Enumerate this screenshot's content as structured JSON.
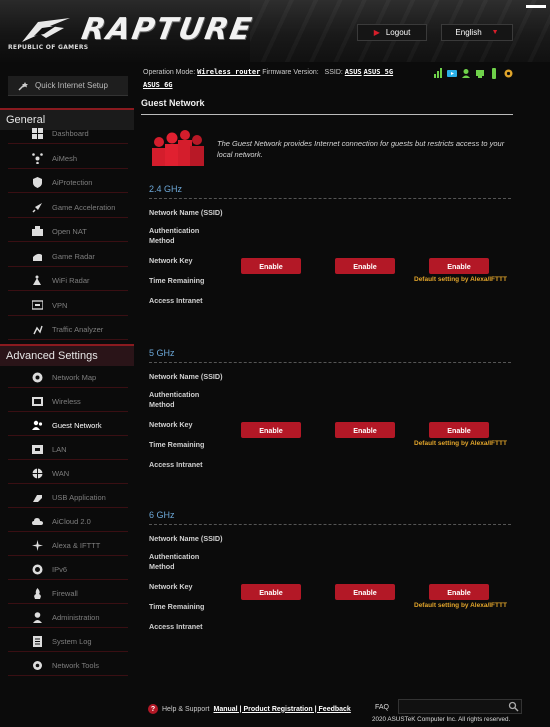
{
  "header": {
    "brand_sub": "REPUBLIC OF GAMERS",
    "brand_title": "RAPTURE",
    "logout_label": "Logout",
    "language": "English"
  },
  "status": {
    "op_mode_label": "Operation Mode:",
    "op_mode_value": "Wireless router",
    "fw_label": "Firmware Version:",
    "ssid_label": "SSID:",
    "ssid_values": [
      "ASUS",
      "ASUS_5G",
      "ASUS_6G"
    ]
  },
  "sidebar": {
    "quick_setup": "Quick Internet Setup",
    "general_header": "General",
    "general_items": [
      {
        "label": "Dashboard",
        "icon": "dashboard-icon"
      },
      {
        "label": "AiMesh",
        "icon": "aimesh-icon"
      },
      {
        "label": "AiProtection",
        "icon": "shield-icon"
      },
      {
        "label": "Game Acceleration",
        "icon": "rocket-icon"
      },
      {
        "label": "Open NAT",
        "icon": "open-nat-icon"
      },
      {
        "label": "Game Radar",
        "icon": "radar-icon"
      },
      {
        "label": "WiFi Radar",
        "icon": "wifi-radar-icon"
      },
      {
        "label": "VPN",
        "icon": "vpn-icon"
      },
      {
        "label": "Traffic Analyzer",
        "icon": "traffic-icon"
      }
    ],
    "advanced_header": "Advanced Settings",
    "advanced_items": [
      {
        "label": "Network Map",
        "icon": "network-map-icon"
      },
      {
        "label": "Wireless",
        "icon": "wireless-icon"
      },
      {
        "label": "Guest Network",
        "icon": "guest-network-icon",
        "active": true
      },
      {
        "label": "LAN",
        "icon": "lan-icon"
      },
      {
        "label": "WAN",
        "icon": "globe-icon"
      },
      {
        "label": "USB Application",
        "icon": "usb-icon"
      },
      {
        "label": "AiCloud 2.0",
        "icon": "cloud-icon"
      },
      {
        "label": "Alexa & IFTTT",
        "icon": "alexa-icon"
      },
      {
        "label": "IPv6",
        "icon": "ipv6-icon"
      },
      {
        "label": "Firewall",
        "icon": "firewall-icon"
      },
      {
        "label": "Administration",
        "icon": "admin-icon"
      },
      {
        "label": "System Log",
        "icon": "system-log-icon"
      },
      {
        "label": "Network Tools",
        "icon": "tools-icon"
      }
    ]
  },
  "main": {
    "title": "Guest Network",
    "intro": "The Guest Network provides Internet connection for guests but restricts access to your local network.",
    "fields": {
      "ssid": "Network Name (SSID)",
      "auth": "Authentication Method",
      "key": "Network Key",
      "time": "Time Remaining",
      "intranet": "Access Intranet"
    },
    "bands": [
      {
        "name": "2.4 GHz",
        "buttons": [
          "Enable",
          "Enable",
          "Enable"
        ],
        "note": "Default setting by Alexa/IFTTT"
      },
      {
        "name": "5 GHz",
        "buttons": [
          "Enable",
          "Enable",
          "Enable"
        ],
        "note": "Default setting by Alexa/IFTTT"
      },
      {
        "name": "6 GHz",
        "buttons": [
          "Enable",
          "Enable",
          "Enable"
        ],
        "note": "Default setting by Alexa/IFTTT"
      }
    ]
  },
  "footer": {
    "help": "Help & Support",
    "links": "Manual | Product Registration | Feedback",
    "faq": "FAQ",
    "copyright": "2020 ASUSTeK Computer Inc. All rights reserved."
  },
  "colors": {
    "accent_red": "#b31826",
    "band_blue": "#6da8d8",
    "note_orange": "#e2a52b"
  }
}
